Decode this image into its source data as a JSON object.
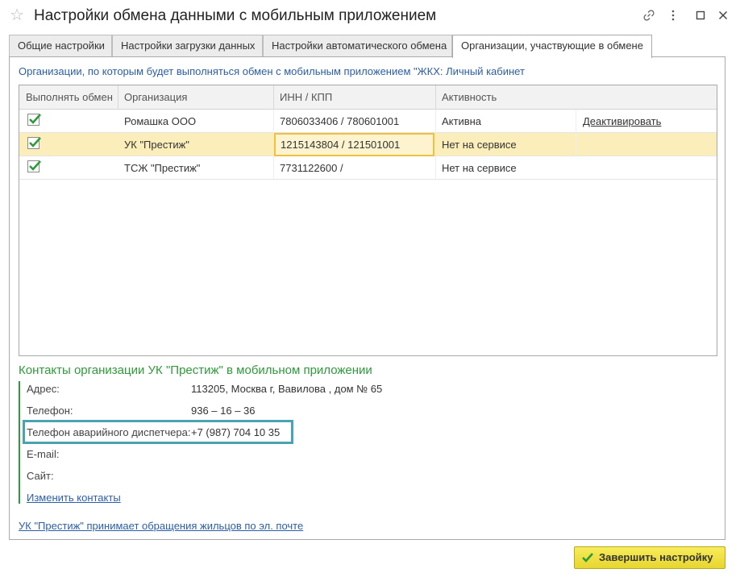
{
  "window": {
    "title": "Настройки обмена данными с мобильным приложением"
  },
  "tabs": [
    {
      "label": "Общие настройки"
    },
    {
      "label": "Настройки загрузки данных"
    },
    {
      "label": "Настройки автоматического обмена"
    },
    {
      "label": "Организации, участвующие в обмене",
      "active": true
    }
  ],
  "panel": {
    "subtitle": "Организации, по которым будет выполняться обмен с мобильным приложением  \"ЖКХ: Личный кабинет"
  },
  "table": {
    "columns": [
      "Выполнять обмен",
      "Организация",
      "ИНН / КПП",
      "Активность"
    ],
    "rows": [
      {
        "exchange": true,
        "organization": "Ромашка ООО",
        "inn_kpp": "7806033406 / 780601001",
        "activity": "Активна",
        "action": "Деактивировать"
      },
      {
        "exchange": true,
        "organization": "УК \"Престиж\"",
        "inn_kpp": "1215143804 / 121501001",
        "activity": "Нет на сервисе",
        "action": "",
        "selected": true
      },
      {
        "exchange": true,
        "organization": "ТСЖ \"Престиж\"",
        "inn_kpp": "7731122600 /",
        "activity": "Нет на сервисе",
        "action": ""
      }
    ]
  },
  "contacts": {
    "title": "Контакты организации УК \"Престиж\" в мобильном приложении",
    "fields": [
      {
        "label": "Адрес:",
        "value": "113205, Москва г, Вавилова , дом № 65"
      },
      {
        "label": "Телефон:",
        "value": "936 – 16 – 36"
      },
      {
        "label": "Телефон аварийного диспетчера:",
        "value": "+7 (987) 704 10 35"
      },
      {
        "label": "E-mail:",
        "value": ""
      },
      {
        "label": "Сайт:",
        "value": ""
      }
    ],
    "edit_link": "Изменить контакты",
    "email_link": "УК \"Престиж\" принимает обращения жильцов по эл. почте"
  },
  "footer": {
    "finish_label": "Завершить настройку"
  },
  "colors": {
    "accent_green": "#2e9a3a",
    "link_blue": "#2b5ea8",
    "selected_row": "#fbeebb",
    "highlight_box": "#4aa3b0",
    "button_yellow": "#f0e24a"
  },
  "icons": [
    "star-icon",
    "link-icon",
    "menu-icon",
    "maximize-icon",
    "close-icon",
    "checkbox-checked-icon",
    "checkmark-icon"
  ]
}
